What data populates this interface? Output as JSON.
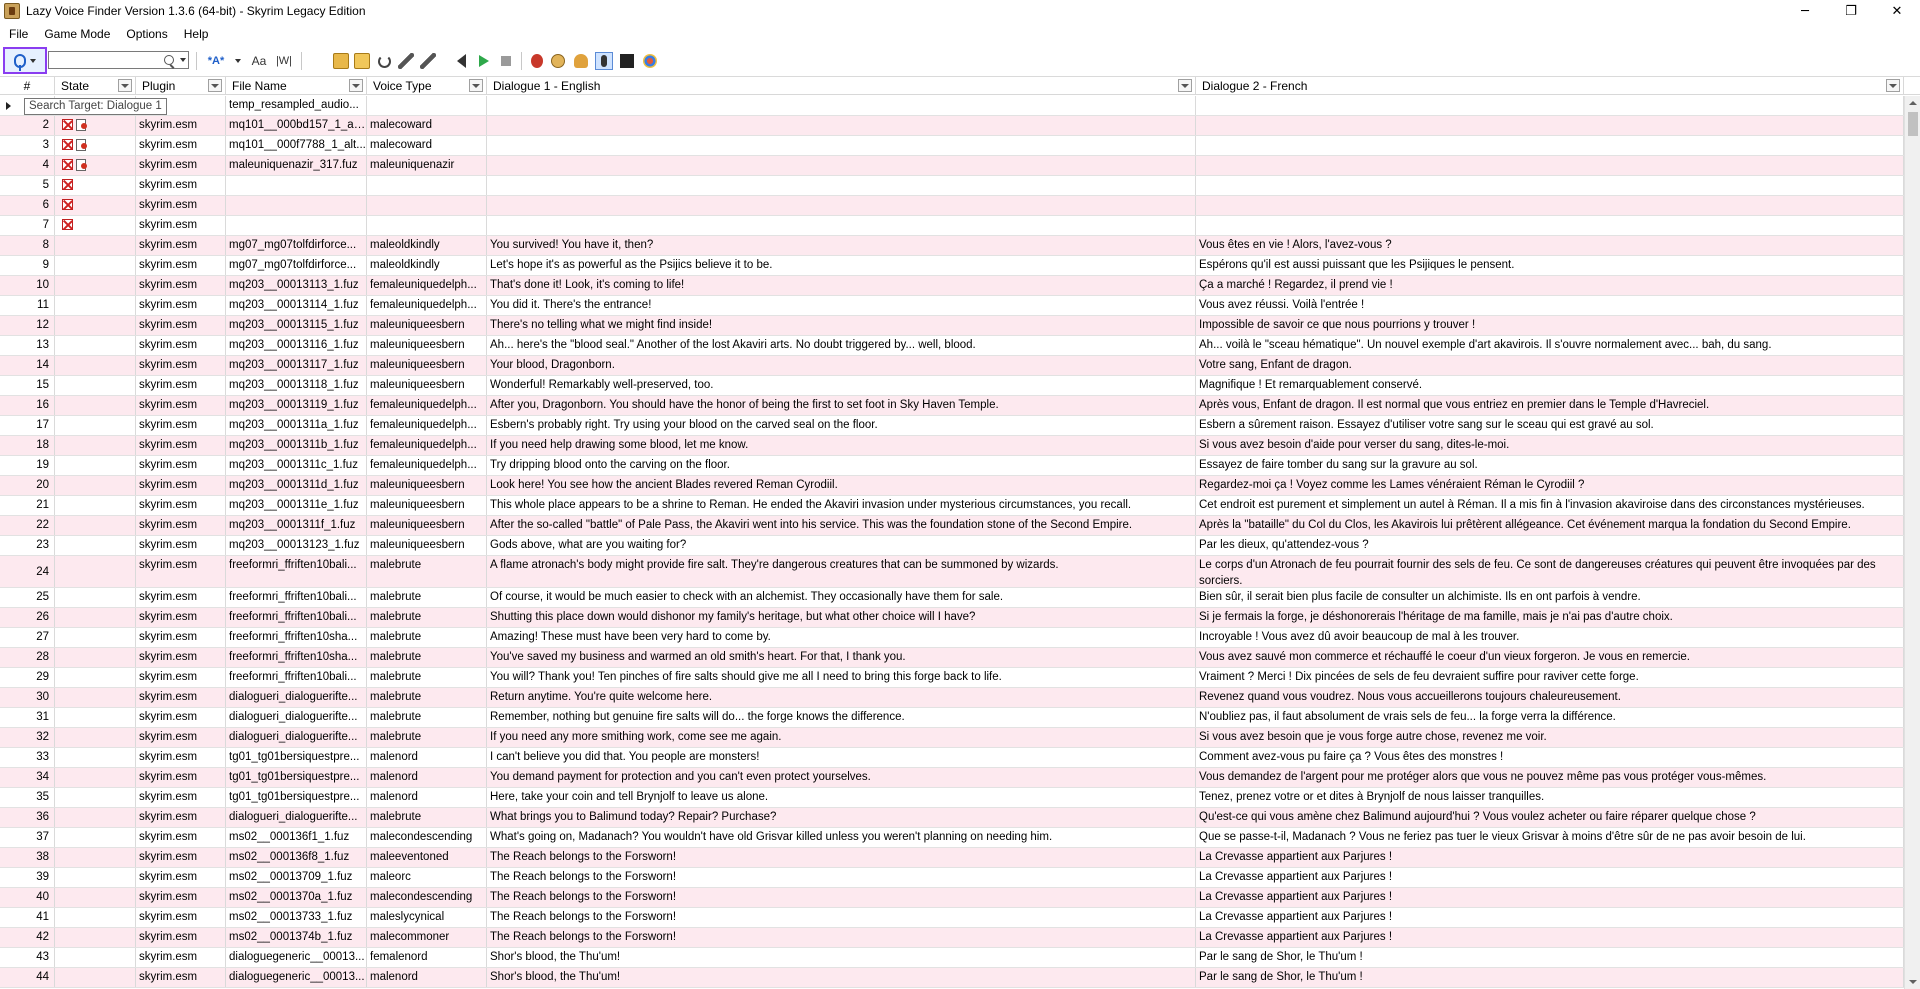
{
  "window": {
    "title": "Lazy Voice Finder Version 1.3.6 (64-bit) - Skyrim Legacy Edition",
    "minimize": "─",
    "restore": "❐",
    "close": "✕"
  },
  "menu": [
    "File",
    "Game Mode",
    "Options",
    "Help"
  ],
  "toolbar": {
    "search_value": "",
    "tooltip": "Search Target: Dialogue 1",
    "case_label": "Aa",
    "word_label": "|W|",
    "match_label": "*A*"
  },
  "columns": [
    "#",
    "State",
    "Plugin",
    "File Name",
    "Voice Type",
    "Dialogue 1 - English",
    "Dialogue 2 - French"
  ],
  "rows": [
    {
      "n": "1",
      "state": "",
      "plugin": "",
      "file": "temp_resampled_audio...",
      "voice": "",
      "d1": "",
      "d2": ""
    },
    {
      "n": "2",
      "state": "xy",
      "plugin": "skyrim.esm",
      "file": "mq101__000bd157_1_alt...",
      "voice": "malecoward",
      "d1": "",
      "d2": ""
    },
    {
      "n": "3",
      "state": "xy",
      "plugin": "skyrim.esm",
      "file": "mq101__000f7788_1_alt...",
      "voice": "malecoward",
      "d1": "",
      "d2": ""
    },
    {
      "n": "4",
      "state": "xy",
      "plugin": "skyrim.esm",
      "file": "maleuniquenazir_317.fuz",
      "voice": "maleuniquenazir",
      "d1": "",
      "d2": ""
    },
    {
      "n": "5",
      "state": "x",
      "plugin": "skyrim.esm",
      "file": "",
      "voice": "",
      "d1": "",
      "d2": ""
    },
    {
      "n": "6",
      "state": "x",
      "plugin": "skyrim.esm",
      "file": "",
      "voice": "",
      "d1": "",
      "d2": ""
    },
    {
      "n": "7",
      "state": "x",
      "plugin": "skyrim.esm",
      "file": "",
      "voice": "",
      "d1": "",
      "d2": ""
    },
    {
      "n": "8",
      "state": "",
      "plugin": "skyrim.esm",
      "file": "mg07_mg07tolfdirforce...",
      "voice": "maleoldkindly",
      "d1": "You survived! You have it, then?",
      "d2": "Vous êtes en vie ! Alors, l'avez-vous ?"
    },
    {
      "n": "9",
      "state": "",
      "plugin": "skyrim.esm",
      "file": "mg07_mg07tolfdirforce...",
      "voice": "maleoldkindly",
      "d1": "Let's hope it's as powerful as the Psijics believe it to be.",
      "d2": "Espérons qu'il est aussi puissant que les Psijiques le pensent."
    },
    {
      "n": "10",
      "state": "",
      "plugin": "skyrim.esm",
      "file": "mq203__00013113_1.fuz",
      "voice": "femaleuniquedelph...",
      "d1": "That's done it! Look, it's coming to life!",
      "d2": "Ça a marché ! Regardez, il prend vie !"
    },
    {
      "n": "11",
      "state": "",
      "plugin": "skyrim.esm",
      "file": "mq203__00013114_1.fuz",
      "voice": "femaleuniquedelph...",
      "d1": "You did it. There's the entrance!",
      "d2": "Vous avez réussi. Voilà l'entrée !"
    },
    {
      "n": "12",
      "state": "",
      "plugin": "skyrim.esm",
      "file": "mq203__00013115_1.fuz",
      "voice": "maleuniqueesbern",
      "d1": "There's no telling what we might find inside!",
      "d2": "Impossible de savoir ce que nous pourrions y trouver !"
    },
    {
      "n": "13",
      "state": "",
      "plugin": "skyrim.esm",
      "file": "mq203__00013116_1.fuz",
      "voice": "maleuniqueesbern",
      "d1": "Ah... here's the \"blood seal.\" Another of the lost Akaviri arts. No doubt triggered by... well, blood.",
      "d2": "Ah... voilà le \"sceau hématique\". Un nouvel exemple d'art akavirois. Il s'ouvre normalement avec... bah, du sang."
    },
    {
      "n": "14",
      "state": "",
      "plugin": "skyrim.esm",
      "file": "mq203__00013117_1.fuz",
      "voice": "maleuniqueesbern",
      "d1": "Your blood, Dragonborn.",
      "d2": "Votre sang, Enfant de dragon."
    },
    {
      "n": "15",
      "state": "",
      "plugin": "skyrim.esm",
      "file": "mq203__00013118_1.fuz",
      "voice": "maleuniqueesbern",
      "d1": "Wonderful! Remarkably well-preserved, too.",
      "d2": "Magnifique ! Et remarquablement conservé."
    },
    {
      "n": "16",
      "state": "",
      "plugin": "skyrim.esm",
      "file": "mq203__00013119_1.fuz",
      "voice": "femaleuniquedelph...",
      "d1": "After you, Dragonborn. You should have the honor of being the first to set foot in Sky Haven Temple.",
      "d2": "Après vous, Enfant de dragon. Il est normal que vous entriez en premier dans le Temple d'Havreciel."
    },
    {
      "n": "17",
      "state": "",
      "plugin": "skyrim.esm",
      "file": "mq203__0001311a_1.fuz",
      "voice": "femaleuniquedelph...",
      "d1": "Esbern's probably right. Try using your blood on the carved seal on the floor.",
      "d2": "Esbern a sûrement raison. Essayez d'utiliser votre sang sur le sceau qui est gravé au sol."
    },
    {
      "n": "18",
      "state": "",
      "plugin": "skyrim.esm",
      "file": "mq203__0001311b_1.fuz",
      "voice": "femaleuniquedelph...",
      "d1": "If you need help drawing some blood, let me know.",
      "d2": "Si vous avez besoin d'aide pour verser du sang, dites-le-moi."
    },
    {
      "n": "19",
      "state": "",
      "plugin": "skyrim.esm",
      "file": "mq203__0001311c_1.fuz",
      "voice": "femaleuniquedelph...",
      "d1": "Try dripping blood onto the carving on the floor.",
      "d2": "Essayez de faire tomber du sang sur la gravure au sol."
    },
    {
      "n": "20",
      "state": "",
      "plugin": "skyrim.esm",
      "file": "mq203__0001311d_1.fuz",
      "voice": "maleuniqueesbern",
      "d1": "Look here! You see how the ancient Blades revered Reman Cyrodiil.",
      "d2": "Regardez-moi ça ! Voyez comme les Lames vénéraient Réman le Cyrodiil ?"
    },
    {
      "n": "21",
      "state": "",
      "plugin": "skyrim.esm",
      "file": "mq203__0001311e_1.fuz",
      "voice": "maleuniqueesbern",
      "d1": "This whole place appears to be a shrine to Reman. He ended the Akaviri invasion under mysterious circumstances, you recall.",
      "d2": "Cet endroit est purement et simplement un autel à Réman. Il a mis fin à l'invasion akaviroise dans des circonstances mystérieuses."
    },
    {
      "n": "22",
      "state": "",
      "plugin": "skyrim.esm",
      "file": "mq203__0001311f_1.fuz",
      "voice": "maleuniqueesbern",
      "d1": "After the so-called \"battle\" of Pale Pass, the Akaviri went into his service. This was the foundation stone of the Second Empire.",
      "d2": "Après la \"bataille\" du Col du Clos, les Akavirois lui prêtèrent allégeance. Cet événement marqua la fondation du Second Empire."
    },
    {
      "n": "23",
      "state": "",
      "plugin": "skyrim.esm",
      "file": "mq203__00013123_1.fuz",
      "voice": "maleuniqueesbern",
      "d1": "Gods above, what are you waiting for?",
      "d2": "Par les dieux, qu'attendez-vous ?"
    },
    {
      "n": "24",
      "state": "",
      "plugin": "skyrim.esm",
      "file": "freeformri_ffriften10bali...",
      "voice": "malebrute",
      "d1": "A flame atronach's body might provide fire salt. They're dangerous creatures that can be summoned by wizards.",
      "d2": "Le corps d'un Atronach de feu pourrait fournir des sels de feu. Ce sont de dangereuses créatures qui peuvent être invoquées par des sorciers.",
      "tall": true
    },
    {
      "n": "25",
      "state": "",
      "plugin": "skyrim.esm",
      "file": "freeformri_ffriften10bali...",
      "voice": "malebrute",
      "d1": "Of course, it would be much easier to check with an alchemist. They occasionally have them for sale.",
      "d2": "Bien sûr, il serait bien plus facile de consulter un alchimiste. Ils en ont parfois à vendre."
    },
    {
      "n": "26",
      "state": "",
      "plugin": "skyrim.esm",
      "file": "freeformri_ffriften10bali...",
      "voice": "malebrute",
      "d1": "Shutting this place down would dishonor my family's heritage, but what other choice will I have?",
      "d2": "Si je fermais la forge, je déshonorerais l'héritage de ma famille, mais je n'ai pas d'autre choix."
    },
    {
      "n": "27",
      "state": "",
      "plugin": "skyrim.esm",
      "file": "freeformri_ffriften10sha...",
      "voice": "malebrute",
      "d1": "Amazing! These must have been very hard to come by.",
      "d2": "Incroyable ! Vous avez dû avoir beaucoup de mal à les trouver."
    },
    {
      "n": "28",
      "state": "",
      "plugin": "skyrim.esm",
      "file": "freeformri_ffriften10sha...",
      "voice": "malebrute",
      "d1": "You've saved my business and warmed an old smith's heart. For that, I thank you.",
      "d2": "Vous avez sauvé mon commerce et réchauffé le coeur d'un vieux forgeron. Je vous en remercie."
    },
    {
      "n": "29",
      "state": "",
      "plugin": "skyrim.esm",
      "file": "freeformri_ffriften10bali...",
      "voice": "malebrute",
      "d1": "You will? Thank you! Ten pinches of fire salts should give me all I need to bring this forge back to life.",
      "d2": "Vraiment ? Merci ! Dix pincées de sels de feu devraient suffire pour raviver cette forge."
    },
    {
      "n": "30",
      "state": "",
      "plugin": "skyrim.esm",
      "file": "dialogueri_dialoguerifte...",
      "voice": "malebrute",
      "d1": "Return anytime. You're quite welcome here.",
      "d2": "Revenez quand vous voudrez. Nous vous accueillerons toujours chaleureusement."
    },
    {
      "n": "31",
      "state": "",
      "plugin": "skyrim.esm",
      "file": "dialogueri_dialoguerifte...",
      "voice": "malebrute",
      "d1": "Remember, nothing but genuine fire salts will do... the forge knows the difference.",
      "d2": "N'oubliez pas, il faut absolument de vrais sels de feu... la forge verra la différence."
    },
    {
      "n": "32",
      "state": "",
      "plugin": "skyrim.esm",
      "file": "dialogueri_dialoguerifte...",
      "voice": "malebrute",
      "d1": "If you need any more smithing work, come see me again.",
      "d2": "Si vous avez besoin que je vous forge autre chose, revenez me voir."
    },
    {
      "n": "33",
      "state": "",
      "plugin": "skyrim.esm",
      "file": "tg01_tg01bersiquestpre...",
      "voice": "malenord",
      "d1": "I can't believe you did that. You people are monsters!",
      "d2": "Comment avez-vous pu faire ça ? Vous êtes des monstres !"
    },
    {
      "n": "34",
      "state": "",
      "plugin": "skyrim.esm",
      "file": "tg01_tg01bersiquestpre...",
      "voice": "malenord",
      "d1": "You demand payment for protection and you can't even protect yourselves.",
      "d2": "Vous demandez de l'argent pour me protéger alors que vous ne pouvez même pas vous protéger vous-mêmes."
    },
    {
      "n": "35",
      "state": "",
      "plugin": "skyrim.esm",
      "file": "tg01_tg01bersiquestpre...",
      "voice": "malenord",
      "d1": "Here, take your coin and tell Brynjolf to leave us alone.",
      "d2": "Tenez, prenez votre or et dites à Brynjolf de nous laisser tranquilles."
    },
    {
      "n": "36",
      "state": "",
      "plugin": "skyrim.esm",
      "file": "dialogueri_dialoguerifte...",
      "voice": "malebrute",
      "d1": "What brings you to Balimund today? Repair? Purchase?",
      "d2": "Qu'est-ce qui vous amène chez Balimund aujourd'hui ? Vous voulez acheter ou faire réparer quelque chose ?"
    },
    {
      "n": "37",
      "state": "",
      "plugin": "skyrim.esm",
      "file": "ms02__000136f1_1.fuz",
      "voice": "malecondescending",
      "d1": "What's going on, Madanach? You wouldn't have old Grisvar killed unless you weren't planning on needing him.",
      "d2": "Que se passe-t-il, Madanach ? Vous ne feriez pas tuer le vieux Grisvar à moins d'être sûr de ne pas avoir besoin de lui."
    },
    {
      "n": "38",
      "state": "",
      "plugin": "skyrim.esm",
      "file": "ms02__000136f8_1.fuz",
      "voice": "maleeventoned",
      "d1": "The Reach belongs to the Forsworn!",
      "d2": "La Crevasse appartient aux Parjures !"
    },
    {
      "n": "39",
      "state": "",
      "plugin": "skyrim.esm",
      "file": "ms02__00013709_1.fuz",
      "voice": "maleorc",
      "d1": "The Reach belongs to the Forsworn!",
      "d2": "La Crevasse appartient aux Parjures !"
    },
    {
      "n": "40",
      "state": "",
      "plugin": "skyrim.esm",
      "file": "ms02__0001370a_1.fuz",
      "voice": "malecondescending",
      "d1": "The Reach belongs to the Forsworn!",
      "d2": "La Crevasse appartient aux Parjures !"
    },
    {
      "n": "41",
      "state": "",
      "plugin": "skyrim.esm",
      "file": "ms02__00013733_1.fuz",
      "voice": "maleslycynical",
      "d1": "The Reach belongs to the Forsworn!",
      "d2": "La Crevasse appartient aux Parjures !"
    },
    {
      "n": "42",
      "state": "",
      "plugin": "skyrim.esm",
      "file": "ms02__0001374b_1.fuz",
      "voice": "malecommoner",
      "d1": "The Reach belongs to the Forsworn!",
      "d2": "La Crevasse appartient aux Parjures !"
    },
    {
      "n": "43",
      "state": "",
      "plugin": "skyrim.esm",
      "file": "dialoguegeneric__00013...",
      "voice": "femalenord",
      "d1": "Shor's blood, the Thu'um!",
      "d2": "Par le sang de Shor, le Thu'um !"
    },
    {
      "n": "44",
      "state": "",
      "plugin": "skyrim.esm",
      "file": "dialoguegeneric__00013...",
      "voice": "malenord",
      "d1": "Shor's blood, the Thu'um!",
      "d2": "Par le sang de Shor, le Thu'um !"
    }
  ]
}
